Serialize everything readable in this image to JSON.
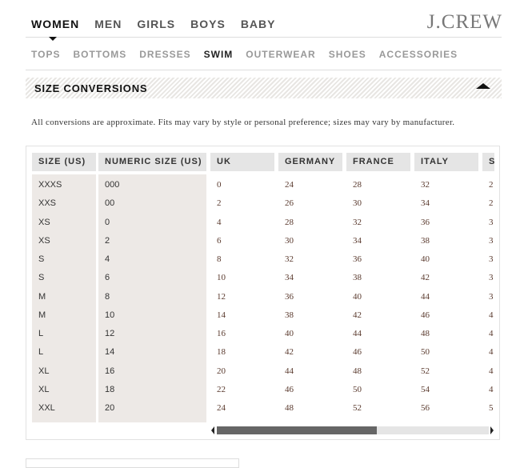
{
  "header": {
    "logo": "J.CREW",
    "categories": [
      {
        "label": "WOMEN",
        "active": true
      },
      {
        "label": "MEN"
      },
      {
        "label": "GIRLS"
      },
      {
        "label": "BOYS"
      },
      {
        "label": "BABY"
      }
    ]
  },
  "subnav": [
    {
      "label": "TOPS"
    },
    {
      "label": "BOTTOMS"
    },
    {
      "label": "DRESSES"
    },
    {
      "label": "SWIM",
      "active": true
    },
    {
      "label": "OUTERWEAR"
    },
    {
      "label": "SHOES"
    },
    {
      "label": "ACCESSORIES"
    }
  ],
  "section": {
    "title": "SIZE CONVERSIONS",
    "note": "All conversions are approximate. Fits may vary by style or personal preference; sizes may vary by manufacturer."
  },
  "table": {
    "headers": [
      "SIZE (US)",
      "NUMERIC SIZE (US)",
      "UK",
      "GERMANY",
      "FRANCE",
      "ITALY",
      "S"
    ],
    "rows": [
      [
        "XXXS",
        "000",
        "0",
        "24",
        "28",
        "32",
        "2"
      ],
      [
        "XXS",
        "00",
        "2",
        "26",
        "30",
        "34",
        "2"
      ],
      [
        "XS",
        "0",
        "4",
        "28",
        "32",
        "36",
        "3"
      ],
      [
        "XS",
        "2",
        "6",
        "30",
        "34",
        "38",
        "3"
      ],
      [
        "S",
        "4",
        "8",
        "32",
        "36",
        "40",
        "3"
      ],
      [
        "S",
        "6",
        "10",
        "34",
        "38",
        "42",
        "3"
      ],
      [
        "M",
        "8",
        "12",
        "36",
        "40",
        "44",
        "3"
      ],
      [
        "M",
        "10",
        "14",
        "38",
        "42",
        "46",
        "4"
      ],
      [
        "L",
        "12",
        "16",
        "40",
        "44",
        "48",
        "4"
      ],
      [
        "L",
        "14",
        "18",
        "42",
        "46",
        "50",
        "4"
      ],
      [
        "XL",
        "16",
        "20",
        "44",
        "48",
        "52",
        "4"
      ],
      [
        "XL",
        "18",
        "22",
        "46",
        "50",
        "54",
        "4"
      ],
      [
        "XXL",
        "20",
        "24",
        "48",
        "52",
        "56",
        "5"
      ]
    ],
    "scroll_position_percent": 0
  }
}
